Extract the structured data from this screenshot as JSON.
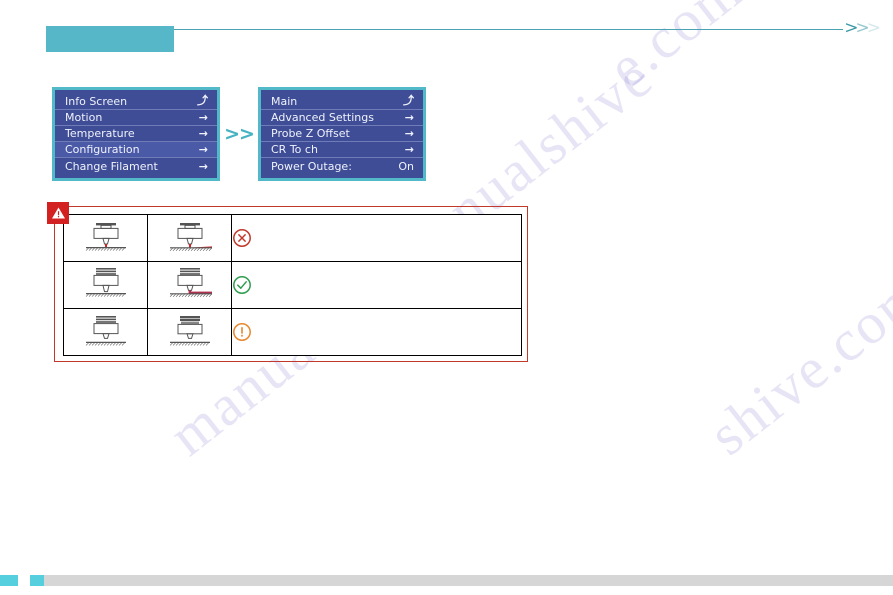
{
  "page": {
    "background_color": "#ffffff",
    "accent_color": "#56b7c9",
    "warning_color": "#d32020"
  },
  "watermark": {
    "text": "manualshive.com",
    "fragments": [
      "e.com",
      "shive.com",
      "manualshi",
      "nualshive"
    ]
  },
  "header": {
    "band_label": "",
    "band_color": "#56b7c9",
    "rule_color": "#4aa3b2",
    "chevrons": [
      ">",
      ">",
      ">"
    ]
  },
  "lcd_panels": {
    "separator": ">>",
    "panel_left": {
      "name": "configuration-menu",
      "rows": [
        {
          "label": "Info Screen",
          "glyph": "⤴",
          "glyph_type": "arrow-up",
          "selected": false
        },
        {
          "label": "Motion",
          "glyph": "→",
          "glyph_type": "arrow-right",
          "selected": false
        },
        {
          "label": "Temperature",
          "glyph": "→",
          "glyph_type": "arrow-right",
          "selected": false
        },
        {
          "label": "Configuration",
          "glyph": "→",
          "glyph_type": "arrow-right",
          "selected": true
        },
        {
          "label": "Change Filament",
          "glyph": "→",
          "glyph_type": "arrow-right",
          "selected": false
        }
      ]
    },
    "panel_right": {
      "name": "advanced-settings-menu",
      "rows": [
        {
          "label": "Main",
          "glyph": "⤴",
          "glyph_type": "arrow-up",
          "selected": false
        },
        {
          "label": "Advanced Settings",
          "glyph": "→",
          "glyph_type": "arrow-right",
          "selected": false
        },
        {
          "label": "Probe Z Offset",
          "glyph": "→",
          "glyph_type": "arrow-right",
          "selected": false
        },
        {
          "label": "CR To  ch",
          "glyph": "→",
          "glyph_type": "arrow-right",
          "selected": false
        },
        {
          "label": "Power Outage:",
          "glyph": "On",
          "glyph_type": "value",
          "selected": false
        }
      ]
    }
  },
  "warning_table": {
    "badge_icon": "warning-triangle-icon",
    "border_color": "#c0392b",
    "rows": [
      {
        "row_id": "too-close",
        "diagram_a": "nozzle-too-close",
        "diagram_b": "nozzle-too-close-extruding",
        "status_icon": "circle-x-icon",
        "status_color": "#c0392b",
        "note": ""
      },
      {
        "row_id": "correct",
        "diagram_a": "nozzle-correct",
        "diagram_b": "nozzle-correct-extruding",
        "status_icon": "circle-check-icon",
        "status_color": "#2e9e4f",
        "note": ""
      },
      {
        "row_id": "too-far",
        "diagram_a": "nozzle-too-far",
        "diagram_b": "nozzle-too-far-extruding",
        "status_icon": "circle-exclamation-icon",
        "status_color": "#e8872b",
        "note": ""
      }
    ]
  },
  "footer": {
    "accent_color": "#55cfdd",
    "bar_color": "#d6d6d6",
    "page_number": ""
  }
}
